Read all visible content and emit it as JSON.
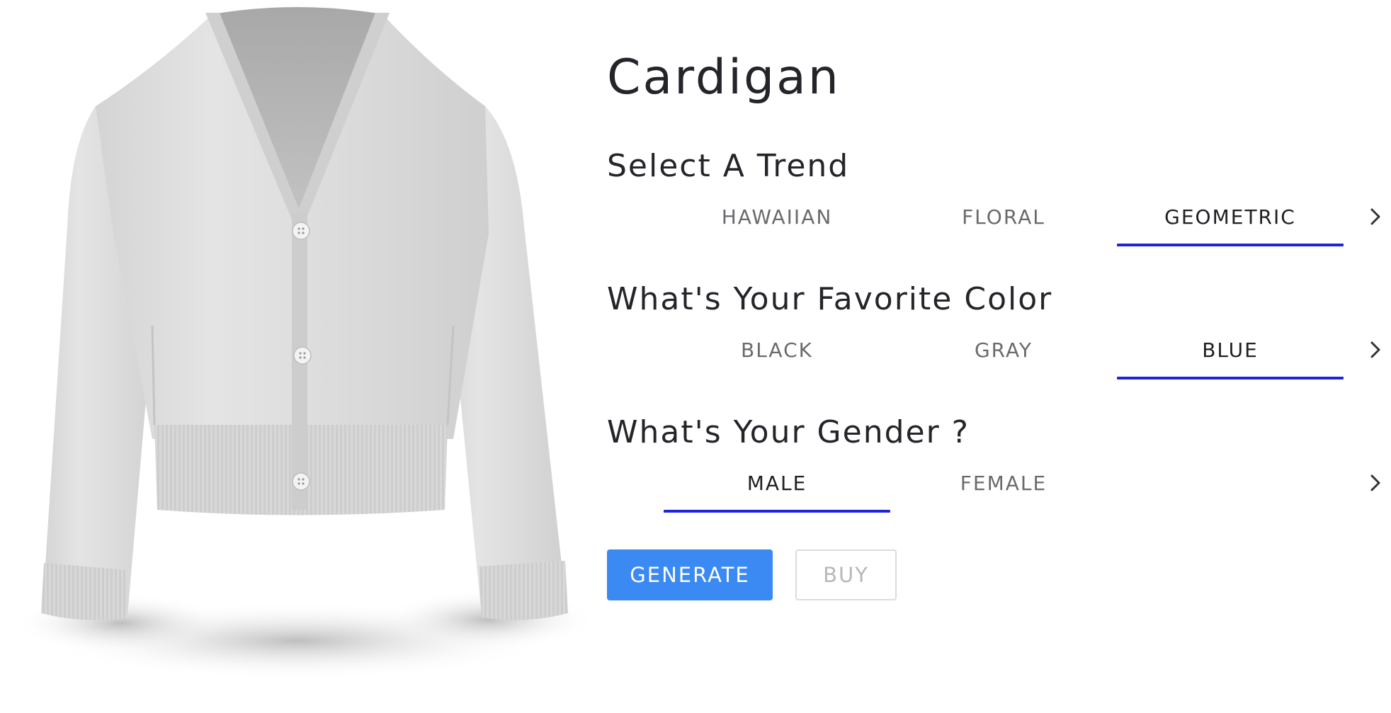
{
  "product": {
    "image_alt": "Cardigan"
  },
  "title": "Cardigan",
  "sections": {
    "trend": {
      "heading": "Select A Trend",
      "options": [
        "HAWAIIAN",
        "FLORAL",
        "GEOMETRIC"
      ],
      "selected": "GEOMETRIC"
    },
    "color": {
      "heading": "What's Your Favorite Color",
      "options": [
        "BLACK",
        "GRAY",
        "BLUE"
      ],
      "selected": "BLUE"
    },
    "gender": {
      "heading": "What's Your Gender ?",
      "options": [
        "MALE",
        "FEMALE"
      ],
      "selected": "MALE"
    }
  },
  "actions": {
    "generate_label": "GENERATE",
    "buy_label": "BUY"
  },
  "colors": {
    "accent_underline": "#1d26d6",
    "primary_button": "#3b89f2"
  },
  "icons": {
    "next": "chevron-right-icon"
  }
}
